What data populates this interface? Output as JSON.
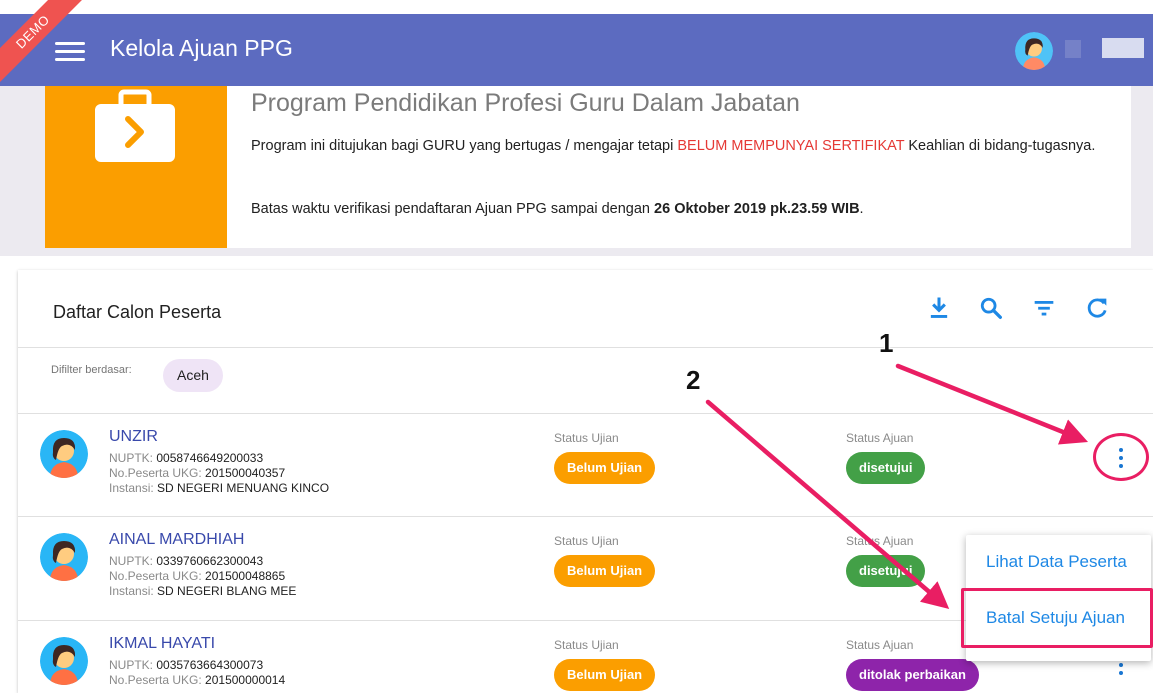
{
  "header": {
    "demo_label": "DEMO",
    "title": "Kelola Ajuan PPG",
    "menu_icon": "hamburger-icon",
    "bar_color": "#5c6bc0"
  },
  "banner": {
    "title": "Program Pendidikan Profesi Guru Dalam Jabatan",
    "text_before": "Program ini ditujukan bagi GURU yang bertugas / mengajar tetapi ",
    "text_highlight": "BELUM MEMPUNYAI SERTIFIKAT",
    "text_after": " Keahlian di bidang-tugasnya.",
    "deadline_before": "Batas waktu verifikasi pendaftaran Ajuan PPG sampai dengan ",
    "deadline_bold": "26 Oktober 2019 pk.23.59 WIB",
    "deadline_after": ".",
    "icon": "briefcase-arrow-icon",
    "accent_color": "#fb9e00"
  },
  "list": {
    "title": "Daftar Calon Peserta",
    "tools": [
      "download-icon",
      "search-icon",
      "filter-icon",
      "refresh-icon"
    ],
    "filter_label": "Difilter berdasar:",
    "filter_chip": "Aceh"
  },
  "labels": {
    "nuptk": "NUPTK: ",
    "ukg": "No.Peserta UKG: ",
    "instansi": "Instansi: ",
    "status_ujian": "Status Ujian",
    "status_ajuan": "Status Ajuan"
  },
  "participants": [
    {
      "name": "UNZIR",
      "nuptk": "0058746649200033",
      "ukg": "201500040357",
      "instansi": "SD NEGERI MENUANG KINCO",
      "status_ujian": "Belum Ujian",
      "status_ajuan": "disetujui",
      "ajuan_color": "#43a047"
    },
    {
      "name": "AINAL MARDHIAH",
      "nuptk": "0339760662300043",
      "ukg": "201500048865",
      "instansi": "SD NEGERI BLANG MEE",
      "status_ujian": "Belum Ujian",
      "status_ajuan": "disetujui",
      "ajuan_color": "#43a047"
    },
    {
      "name": "IKMAL HAYATI",
      "nuptk": "0035763664300073",
      "ukg": "201500000014",
      "instansi": "",
      "status_ujian": "Belum Ujian",
      "status_ajuan": "ditolak perbaikan",
      "ajuan_color": "#8e24aa"
    }
  ],
  "context_menu": {
    "items": [
      "Lihat Data Peserta",
      "Batal Setuju Ajuan"
    ]
  },
  "annotations": {
    "marker_1": "1",
    "marker_2": "2",
    "color": "#e91e63"
  }
}
